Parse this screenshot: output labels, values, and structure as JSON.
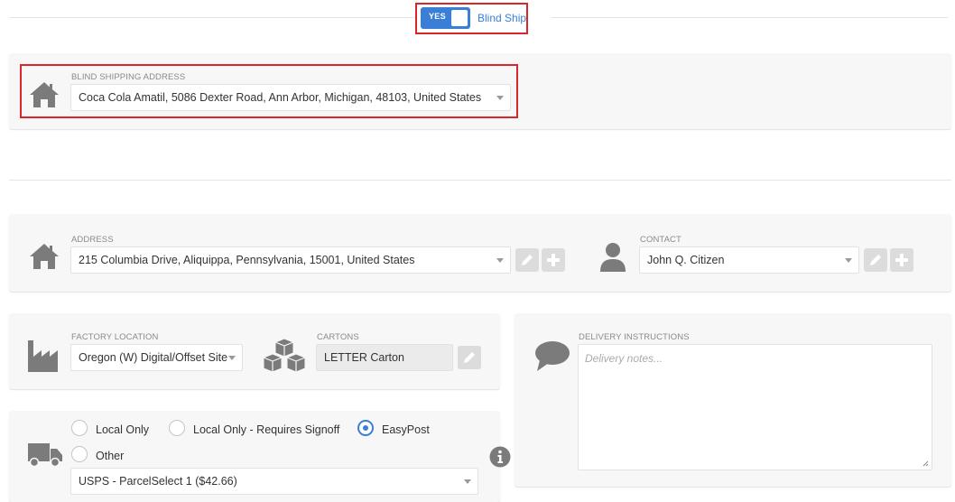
{
  "blind_ship": {
    "toggle_label": "YES",
    "label": "Blind Ship",
    "enabled": true
  },
  "blind_address": {
    "label": "BLIND SHIPPING ADDRESS",
    "value": "Coca Cola Amatil, 5086 Dexter Road, Ann Arbor, Michigan, 48103, United States"
  },
  "address": {
    "label": "ADDRESS",
    "value": "215 Columbia Drive, Aliquippa, Pennsylvania, 15001, United States"
  },
  "contact": {
    "label": "CONTACT",
    "value": "John Q. Citizen"
  },
  "factory": {
    "label": "FACTORY LOCATION",
    "value": "Oregon (W) Digital/Offset Site"
  },
  "cartons": {
    "label": "CARTONS",
    "value": "LETTER Carton"
  },
  "delivery": {
    "label": "DELIVERY INSTRUCTIONS",
    "placeholder": "Delivery notes..."
  },
  "shipping": {
    "options": [
      "Local Only",
      "Local Only - Requires Signoff",
      "EasyPost",
      "Other"
    ],
    "selected": "EasyPost",
    "service": "USPS - ParcelSelect 1 ($42.66)"
  },
  "colors": {
    "accent": "#3a7fd5",
    "highlight": "#d9252c",
    "icon": "#7b7b7b"
  }
}
